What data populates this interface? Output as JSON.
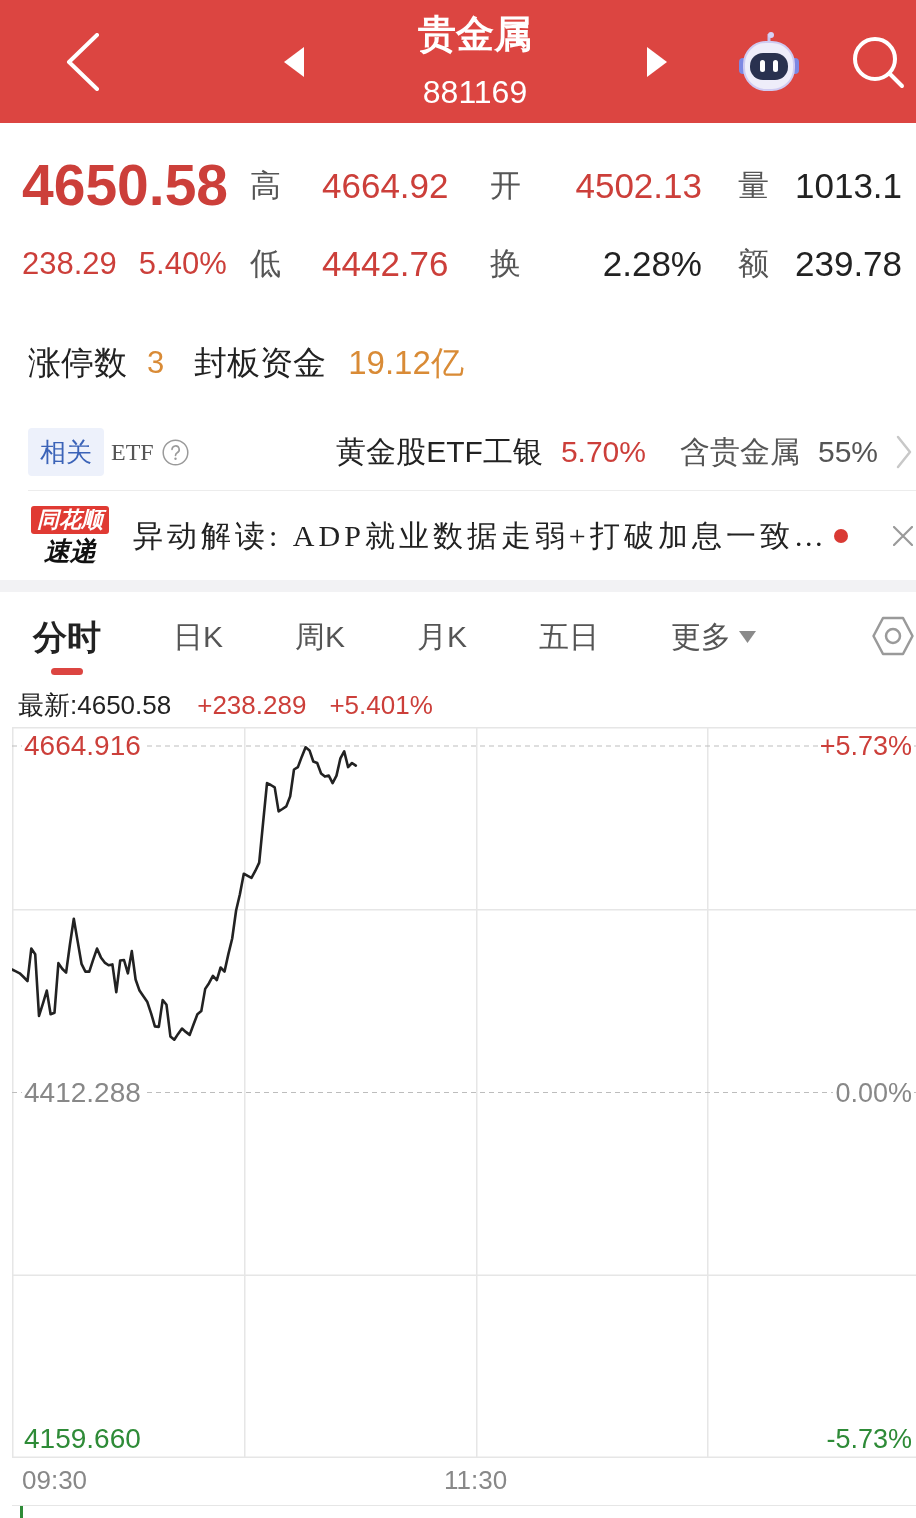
{
  "header": {
    "title": "贵金属",
    "code": "881169"
  },
  "quote": {
    "price": "4650.58",
    "change": "238.29",
    "change_pct": "5.40%",
    "stats": [
      {
        "label": "高",
        "value": "4664.92",
        "kind": "up"
      },
      {
        "label": "开",
        "value": "4502.13",
        "kind": "up"
      },
      {
        "label": "量",
        "value": "1013.1",
        "kind": "plain"
      },
      {
        "label": "低",
        "value": "4442.76",
        "kind": "up"
      },
      {
        "label": "换",
        "value": "2.28%",
        "kind": "plain"
      },
      {
        "label": "额",
        "value": "239.78",
        "kind": "plain"
      }
    ]
  },
  "limit_up": {
    "count_label": "涨停数",
    "count": "3",
    "fund_label": "封板资金",
    "fund": "19.12亿"
  },
  "related_etf": {
    "tag": "相关",
    "label": "ETF",
    "name": "黄金股ETF工银",
    "change": "5.70%",
    "holding_label": "含贵金属",
    "holding": "55%"
  },
  "news": {
    "source": "同花顺",
    "source_sub": "速递",
    "text": "异动解读: ADP就业数据走弱+打破加息一致…",
    "unread": true
  },
  "tabs": [
    {
      "label": "分时",
      "kind": "tab",
      "selected": true
    },
    {
      "label": "日K",
      "kind": "tab",
      "selected": false
    },
    {
      "label": "周K",
      "kind": "tab",
      "selected": false
    },
    {
      "label": "月K",
      "kind": "tab",
      "selected": false
    },
    {
      "label": "五日",
      "kind": "tab",
      "selected": false
    },
    {
      "label": "更多",
      "kind": "menu",
      "selected": false
    }
  ],
  "chart": {
    "latest": "最新:4650.58",
    "change": "+238.289",
    "change_pct": "+5.401%",
    "percent_labels": [
      {
        "label": "+5.73%",
        "kind": "up"
      },
      {
        "label": "0.00%",
        "kind": "flat"
      },
      {
        "label": "-5.73%",
        "kind": "down"
      }
    ],
    "time_labels": [
      "09:30",
      "11:30"
    ],
    "chart_data": {
      "type": "line",
      "categories": [
        null,
        null,
        null,
        null,
        null,
        null,
        null,
        null,
        null,
        null,
        null,
        null,
        null,
        null,
        null,
        null,
        null,
        null,
        null,
        null,
        null,
        null,
        null,
        null,
        null,
        null,
        null,
        null,
        null,
        null,
        null,
        null,
        null,
        null,
        null,
        null,
        null,
        null,
        null,
        null,
        null,
        null,
        null,
        null,
        null,
        null,
        null,
        null,
        null,
        null,
        null,
        null,
        null,
        null,
        null,
        null,
        null,
        null,
        null,
        null,
        null,
        null,
        null,
        null,
        null,
        null,
        null,
        null,
        null,
        null,
        null,
        null,
        null,
        null,
        null,
        null,
        null,
        null,
        null,
        null,
        null,
        null,
        null,
        null,
        null,
        null,
        null,
        null,
        null,
        null,
        null,
        null,
        null,
        null,
        null,
        null,
        null,
        null,
        null,
        null,
        null,
        null,
        null,
        null,
        null,
        null,
        null,
        null,
        null,
        null,
        null,
        null,
        null,
        null,
        null,
        null,
        null,
        null,
        null,
        null,
        null,
        null,
        null,
        null,
        null,
        null,
        null,
        null,
        null,
        null,
        null,
        null,
        null,
        null,
        null,
        null,
        null,
        null,
        null,
        null,
        null,
        null,
        null,
        null,
        null,
        null,
        null,
        null,
        null,
        null,
        null,
        null,
        null,
        null,
        null,
        null,
        null,
        null,
        null,
        null,
        null,
        null,
        null,
        null,
        null,
        null,
        null,
        null,
        null,
        null,
        null,
        null,
        null,
        null,
        null,
        null,
        null,
        null,
        null,
        null,
        null,
        null,
        null,
        null,
        null,
        null,
        null,
        null,
        null,
        null,
        null,
        null,
        null,
        null,
        null,
        null,
        null,
        null,
        null,
        null,
        null,
        null,
        null,
        null,
        null,
        null,
        null,
        null,
        null,
        null,
        null,
        null,
        null,
        null,
        null,
        null,
        null,
        null,
        null,
        null,
        null,
        null,
        null,
        null,
        null,
        null,
        null,
        null,
        null,
        null,
        null,
        null,
        null,
        null,
        null
      ],
      "series": [
        {
          "color": "#222222",
          "values": [
            4502.0,
            4500.6,
            4499.2,
            4496.5,
            4493.5,
            4517.2,
            4513.1,
            4468.1,
            4477.0,
            4486.6,
            4469.3,
            4470.5,
            4506.6,
            4502.5,
            4499.7,
            4520.0,
            4538.9,
            4522.3,
            4506.1,
            4500.4,
            4500.4,
            4509.0,
            4517.2,
            4510.8,
            4507.0,
            4505.0,
            4505.7,
            4485.4,
            4508.5,
            4508.9,
            4499.2,
            4515.4,
            4494.7,
            4486.6,
            4482.5,
            4478.5,
            4470.0,
            4460.5,
            4460.1,
            4479.7,
            4476.2,
            4453.2,
            4450.8,
            4455.0,
            4458.9,
            4456.5,
            4454.3,
            4462.0,
            4469.3,
            4471.6,
            4487.8,
            4492.0,
            4497.4,
            4494.2,
            4503.4,
            4500.4,
            4513.0,
            4524.6,
            4545.0,
            4556.9,
            4571.8,
            4570.3,
            4568.8,
            4574.0,
            4579.9,
            4609.0,
            4637.9,
            4636.5,
            4634.7,
            4617.2,
            4619.0,
            4620.9,
            4628.3,
            4647.8,
            4649.5,
            4657.0,
            4664.0,
            4661.7,
            4653.6,
            4652.5,
            4644.9,
            4642.6,
            4643.3,
            4637.9,
            4643.3,
            4655.9,
            4661.0,
            4649.5,
            4652.5,
            4650.6,
            null,
            null,
            null,
            null,
            null,
            null,
            null,
            null,
            null,
            null,
            null,
            null,
            null,
            null,
            null,
            null,
            null,
            null,
            null,
            null,
            null,
            null,
            null,
            null,
            null,
            null,
            null,
            null,
            null,
            null,
            null,
            null,
            null,
            null,
            null,
            null,
            null,
            null,
            null,
            null,
            null,
            null,
            null,
            null,
            null,
            null,
            null,
            null,
            null,
            null,
            null,
            null,
            null,
            null,
            null,
            null,
            null,
            null,
            null,
            null,
            null,
            null,
            null,
            null,
            null,
            null,
            null,
            null,
            null,
            null,
            null,
            null,
            null,
            null,
            null,
            null,
            null,
            null,
            null,
            null,
            null,
            null,
            null,
            null,
            null,
            null,
            null,
            null,
            null,
            null,
            null,
            null,
            null,
            null,
            null,
            null,
            null,
            null,
            null,
            null,
            null,
            null,
            null,
            null,
            null,
            null,
            null,
            null,
            null,
            null,
            null,
            null,
            null,
            null,
            null,
            null,
            null,
            null,
            null,
            null,
            null,
            null,
            null,
            null,
            null,
            null,
            null,
            null,
            null,
            null,
            null,
            null,
            null,
            null,
            null,
            null,
            null,
            null,
            null,
            null,
            null,
            null,
            null,
            null,
            null
          ]
        }
      ],
      "ylim": [
        4145.81,
        4678.766
      ],
      "yticks": [
        {
          "value": 4664.916,
          "label": "4664.916"
        },
        {
          "value": 4412.288,
          "label": "4412.288"
        },
        {
          "value": 4159.66,
          "label": "4159.660"
        }
      ]
    }
  }
}
